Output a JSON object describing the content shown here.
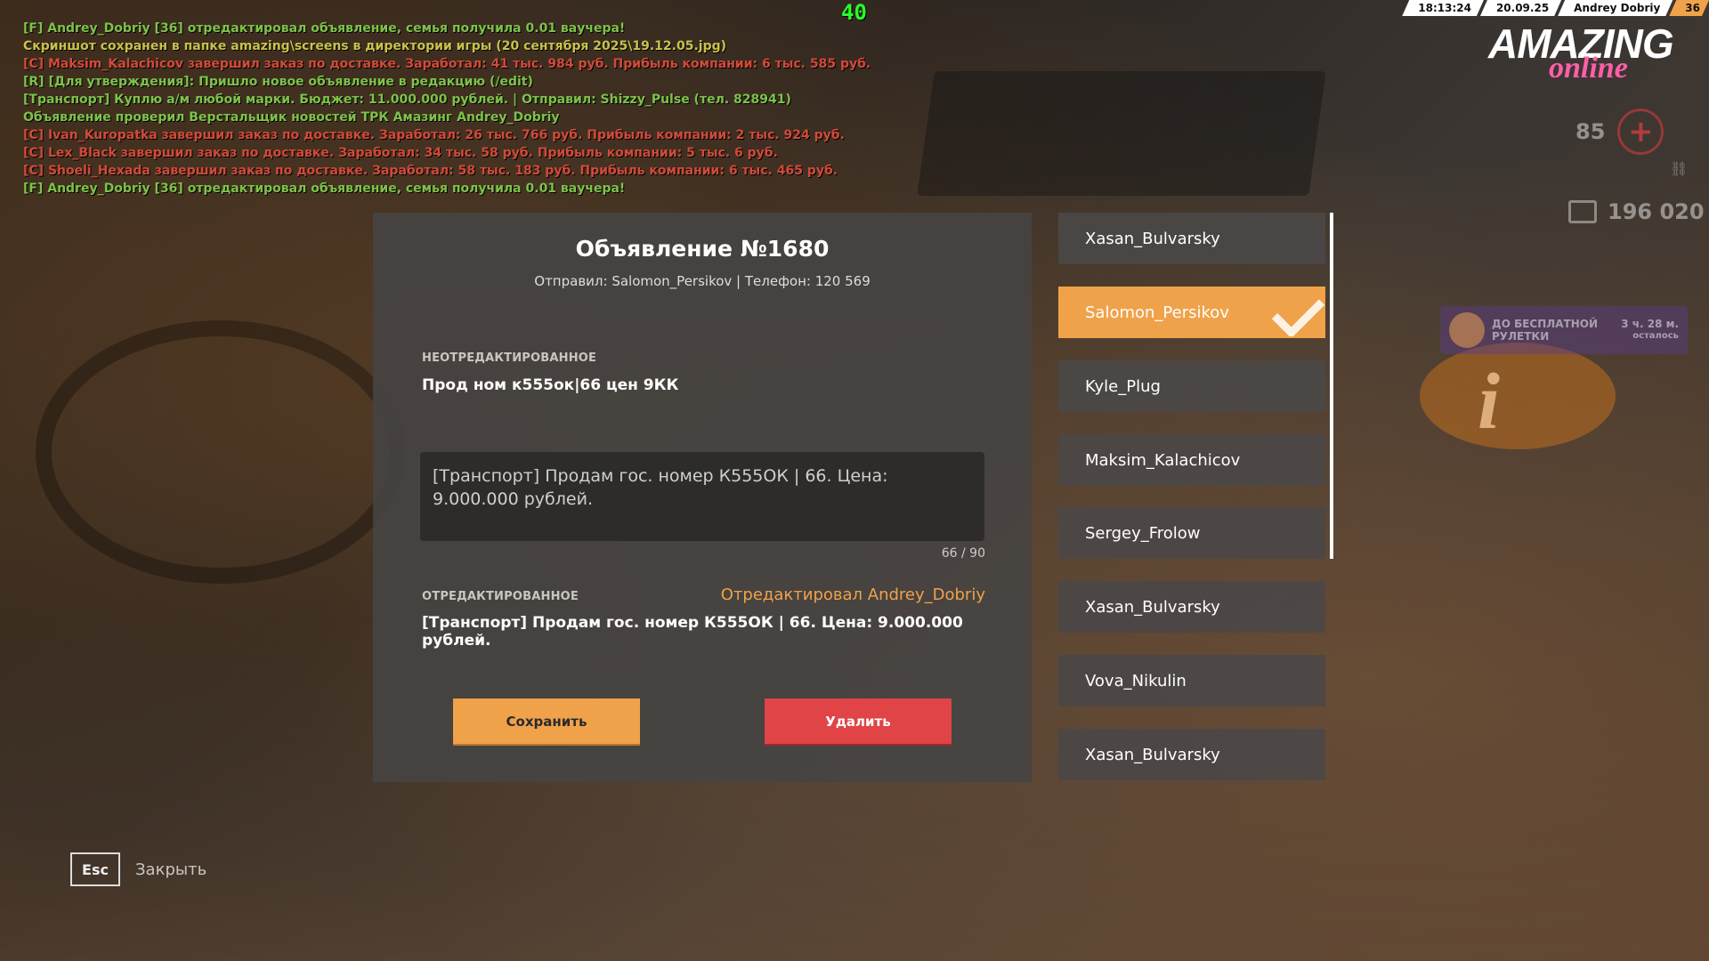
{
  "hud": {
    "fps": "40",
    "time": "18:13:24",
    "date": "20.09.25",
    "player": "Andrey Dobriy",
    "level": "36",
    "logo_main": "AMAZING",
    "logo_sub": "online",
    "health": "85",
    "money": "196 020",
    "roulette_text": "ДО БЕСПЛАТНОЙ РУЛЕТКИ",
    "roulette_time": "3 ч. 28 м.",
    "roulette_left": "осталось"
  },
  "chat": [
    {
      "text": "[F] Andrey_Dobriy [36] отредактировал объявление, семья получила 0.01 ваучера!",
      "color": "green"
    },
    {
      "text": "Скриншот сохранен в папке amazing\\screens в директории игры (20 сентября 2025\\19.12.05.jpg)",
      "color": "yellow"
    },
    {
      "text": "[C] Maksim_Kalachicov завершил заказ по доставке. Заработал: 41 тыс. 984 руб. Прибыль компании: 6 тыс. 585 руб.",
      "color": "red"
    },
    {
      "text": "[R] [Для утверждения]: Пришло новое объявление в редакцию (/edit)",
      "color": "green"
    },
    {
      "text": "[Транспорт] Куплю а/м любой марки. Бюджет: 11.000.000 рублей. | Отправил: Shizzy_Pulse (тел. 828941)",
      "color": "green"
    },
    {
      "text": "Объявление проверил Верстальщик новостей ТРК Амазинг Andrey_Dobriy",
      "color": "green"
    },
    {
      "text": "[C] Ivan_Kuropatka завершил заказ по доставке. Заработал: 26 тыс. 766 руб. Прибыль компании: 2 тыс. 924 руб.",
      "color": "red"
    },
    {
      "text": "[C] Lex_Black завершил заказ по доставке. Заработал: 34 тыс. 58 руб. Прибыль компании: 5 тыс. 6 руб.",
      "color": "red"
    },
    {
      "text": "[C] Shoeli_Hexada завершил заказ по доставке. Заработал: 58 тыс. 183 руб. Прибыль компании: 6 тыс. 465 руб.",
      "color": "red"
    },
    {
      "text": "[F] Andrey_Dobriy [36] отредактировал объявление, семья получила 0.01 ваучера!",
      "color": "green"
    }
  ],
  "ad": {
    "title": "Объявление №1680",
    "meta": "Отправил: Salomon_Persikov | Телефон: 120 569",
    "original_label": "НЕОТРЕДАКТИРОВАННОЕ",
    "original_text": "Прод ном к555ок|66 цен 9КК",
    "textarea_value": "[Транспорт] Продам гос. номер К555ОК | 66. Цена: 9.000.000 рублей.",
    "counter": "66 / 90",
    "edited_label": "ОТРЕДАКТИРОВАННОЕ",
    "edited_by": "Отредактировал Andrey_Dobriy",
    "edited_text": "[Транспорт] Продам гос. номер К555ОК | 66. Цена: 9.000.000 рублей.",
    "save_label": "Сохранить",
    "delete_label": "Удалить"
  },
  "senders": [
    {
      "name": "Xasan_Bulvarsky",
      "active": false
    },
    {
      "name": "Salomon_Persikov",
      "active": true
    },
    {
      "name": "Kyle_Plug",
      "active": false
    },
    {
      "name": "Maksim_Kalachicov",
      "active": false
    },
    {
      "name": "Sergey_Frolow",
      "active": false
    },
    {
      "name": "Xasan_Bulvarsky",
      "active": false
    },
    {
      "name": "Vova_Nikulin",
      "active": false
    },
    {
      "name": "Xasan_Bulvarsky",
      "active": false
    }
  ],
  "footer": {
    "esc_key": "Esc",
    "esc_label": "Закрыть"
  },
  "colors": {
    "accent": "#f0a24a",
    "danger": "#e04446",
    "fps": "#28ff28"
  }
}
